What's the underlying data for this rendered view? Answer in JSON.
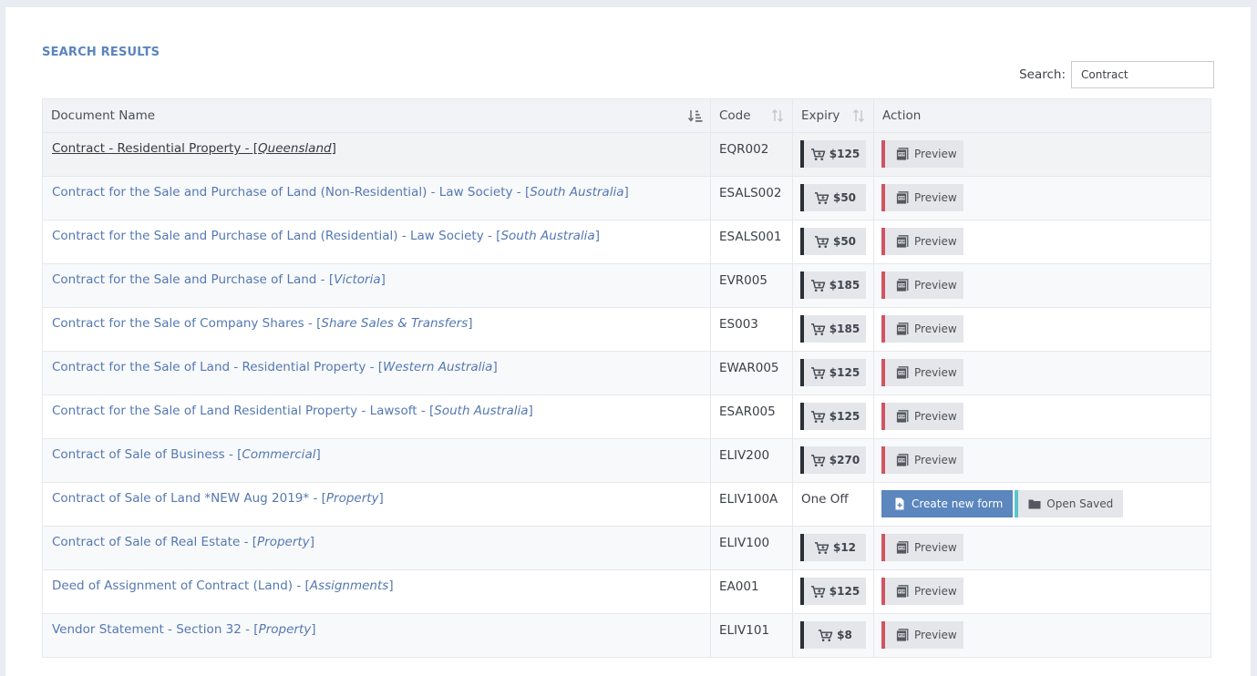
{
  "page": {
    "title": "SEARCH RESULTS",
    "search_label": "Search:",
    "search_value": "Contract"
  },
  "table": {
    "headers": {
      "name": "Document Name",
      "code": "Code",
      "expiry": "Expiry",
      "action": "Action"
    },
    "rows": [
      {
        "name": "Contract - Residential Property - [",
        "region": "Queensland",
        "code": "EQR002",
        "price": "$125",
        "action": "preview",
        "preview_label": "Preview",
        "active": true
      },
      {
        "name": "Contract for the Sale and Purchase of Land (Non-Residential) - Law Society - [",
        "region": "South Australia",
        "code": "ESALS002",
        "price": "$50",
        "action": "preview",
        "preview_label": "Preview"
      },
      {
        "name": "Contract for the Sale and Purchase of Land (Residential) - Law Society - [",
        "region": "South Australia",
        "code": "ESALS001",
        "price": "$50",
        "action": "preview",
        "preview_label": "Preview"
      },
      {
        "name": "Contract for the Sale and Purchase of Land - [",
        "region": "Victoria",
        "code": "EVR005",
        "price": "$185",
        "action": "preview",
        "preview_label": "Preview"
      },
      {
        "name": "Contract for the Sale of Company Shares - [",
        "region": "Share Sales & Transfers",
        "code": "ES003",
        "price": "$185",
        "action": "preview",
        "preview_label": "Preview"
      },
      {
        "name": "Contract for the Sale of Land - Residential Property - [",
        "region": "Western Australia",
        "code": "EWAR005",
        "price": "$125",
        "action": "preview",
        "preview_label": "Preview"
      },
      {
        "name": "Contract for the Sale of Land Residential Property - Lawsoft - [",
        "region": "South Australia",
        "code": "ESAR005",
        "price": "$125",
        "action": "preview",
        "preview_label": "Preview"
      },
      {
        "name": "Contract of Sale of Business - [",
        "region": "Commercial",
        "code": "ELIV200",
        "price": "$270",
        "action": "preview",
        "preview_label": "Preview"
      },
      {
        "name": "Contract of Sale of Land *NEW Aug 2019* - [",
        "region": "Property",
        "code": "ELIV100A",
        "expiry_text": "One Off",
        "action": "form",
        "create_label": "Create new form",
        "open_label": "Open Saved"
      },
      {
        "name": "Contract of Sale of Real Estate - [",
        "region": "Property",
        "code": "ELIV100",
        "price": "$12",
        "action": "preview",
        "preview_label": "Preview"
      },
      {
        "name": "Deed of Assignment of Contract (Land) - [",
        "region": "Assignments",
        "code": "EA001",
        "price": "$125",
        "action": "preview",
        "preview_label": "Preview"
      },
      {
        "name": "Vendor Statement - Section 32 - [",
        "region": "Property",
        "code": "ELIV101",
        "price": "$8",
        "action": "preview",
        "preview_label": "Preview"
      }
    ]
  },
  "icons": {
    "sort_active": "sort-amount-down-icon",
    "sort": "sort-icon",
    "price": "cart-icon",
    "preview": "pdf-file-icon",
    "create": "file-plus-icon",
    "open": "folder-icon"
  },
  "colors": {
    "title": "#5b85bd",
    "link": "#5478b2",
    "create_button": "#5b86be",
    "preview_accent": "#d05461",
    "price_accent": "#2b2f36",
    "open_accent": "#5cc4d0"
  }
}
